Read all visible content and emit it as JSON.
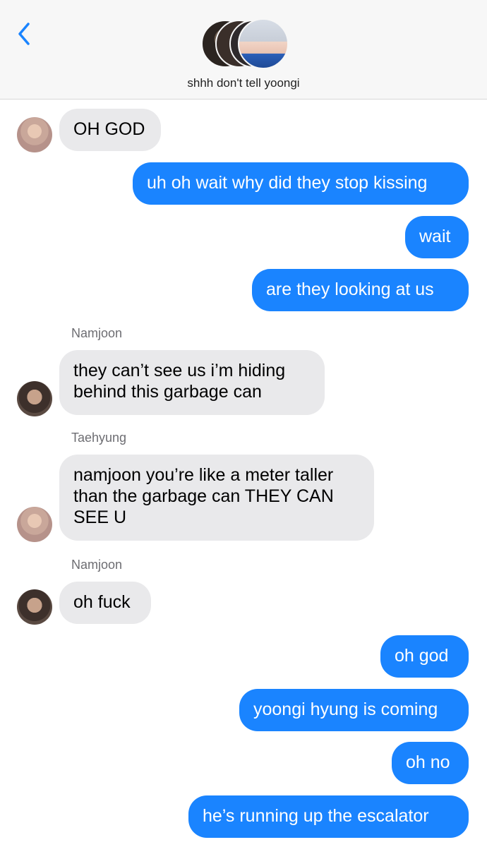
{
  "header": {
    "back_icon": "chevron-left-icon",
    "title": "shhh don't tell yoongi",
    "accent": "#1a84ff"
  },
  "messages": [
    {
      "side": "in",
      "text": "OH GOD"
    },
    {
      "side": "out",
      "text": "uh oh wait why did they stop kissing"
    },
    {
      "side": "out",
      "text": "wait"
    },
    {
      "side": "out",
      "text": "are they looking at us"
    },
    {
      "side": "in",
      "sender": "Namjoon",
      "text": "they can’t see us i’m hiding behind this garbage can"
    },
    {
      "side": "in",
      "sender": "Taehyung",
      "text": "namjoon you’re like a meter taller than the garbage can THEY CAN SEE U"
    },
    {
      "side": "in",
      "sender": "Namjoon",
      "text": "oh fuck"
    },
    {
      "side": "out",
      "text": "oh god"
    },
    {
      "side": "out",
      "text": "yoongi hyung is coming"
    },
    {
      "side": "out",
      "text": "oh no"
    },
    {
      "side": "out",
      "text": "he’s running up the escalator"
    }
  ]
}
